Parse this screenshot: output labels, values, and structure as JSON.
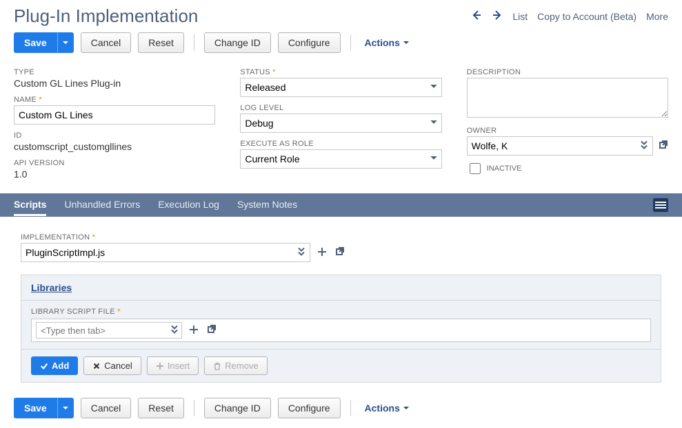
{
  "header": {
    "title": "Plug-In Implementation",
    "links": {
      "list": "List",
      "copy": "Copy to Account (Beta)",
      "more": "More"
    }
  },
  "toolbar": {
    "save": "Save",
    "cancel": "Cancel",
    "reset": "Reset",
    "change_id": "Change ID",
    "configure": "Configure",
    "actions": "Actions"
  },
  "fields": {
    "left": {
      "type_label": "TYPE",
      "type_value": "Custom GL Lines Plug-in",
      "name_label": "NAME",
      "name_value": "Custom GL Lines",
      "id_label": "ID",
      "id_value": "customscript_customgllines",
      "api_label": "API VERSION",
      "api_value": "1.0"
    },
    "middle": {
      "status_label": "STATUS",
      "status_value": "Released",
      "loglevel_label": "LOG LEVEL",
      "loglevel_value": "Debug",
      "exec_label": "EXECUTE AS ROLE",
      "exec_value": "Current Role"
    },
    "right": {
      "desc_label": "DESCRIPTION",
      "desc_value": "",
      "owner_label": "OWNER",
      "owner_value": "Wolfe, K",
      "inactive_label": "INACTIVE"
    }
  },
  "tabs": {
    "scripts": "Scripts",
    "errors": "Unhandled Errors",
    "execlog": "Execution Log",
    "notes": "System Notes"
  },
  "impl": {
    "label": "IMPLEMENTATION",
    "value": "PluginScriptImpl.js"
  },
  "libraries": {
    "title": "Libraries",
    "file_label": "LIBRARY SCRIPT FILE",
    "placeholder": "<Type then tab>",
    "actions": {
      "add": "Add",
      "cancel": "Cancel",
      "insert": "Insert",
      "remove": "Remove"
    }
  }
}
